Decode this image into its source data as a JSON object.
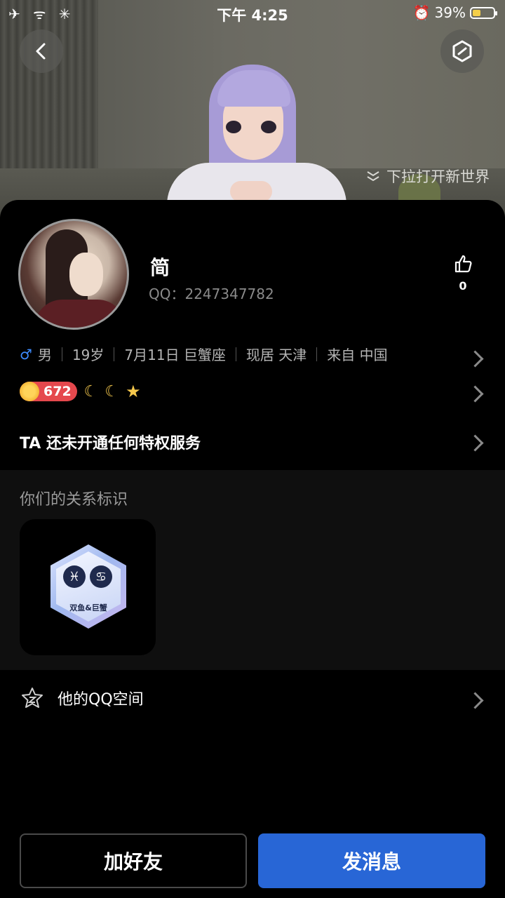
{
  "status_bar": {
    "time": "下午 4:25",
    "battery": "39%",
    "left_icons": "✈ ᯤ ✳"
  },
  "hero": {
    "hint": "下拉打开新世界"
  },
  "profile": {
    "name": "简",
    "qq": "QQ：2247347782",
    "likes": "0",
    "gender": "男",
    "age": "19岁",
    "birthday": "7月11日 巨蟹座",
    "residence": "现居 天津",
    "hometown": "来自 中国",
    "level": "672",
    "privilege": "TA 还未开通任何特权服务"
  },
  "relation": {
    "title": "你们的关系标识",
    "badge_label": "双鱼&巨蟹"
  },
  "qzone": {
    "label": "他的QQ空间"
  },
  "actions": {
    "add_friend": "加好友",
    "send_message": "发消息"
  },
  "colors": {
    "primary": "#2866D6",
    "male": "#3D8BFF",
    "level_badge": "#E5484D",
    "battery": "#F5D04A"
  }
}
